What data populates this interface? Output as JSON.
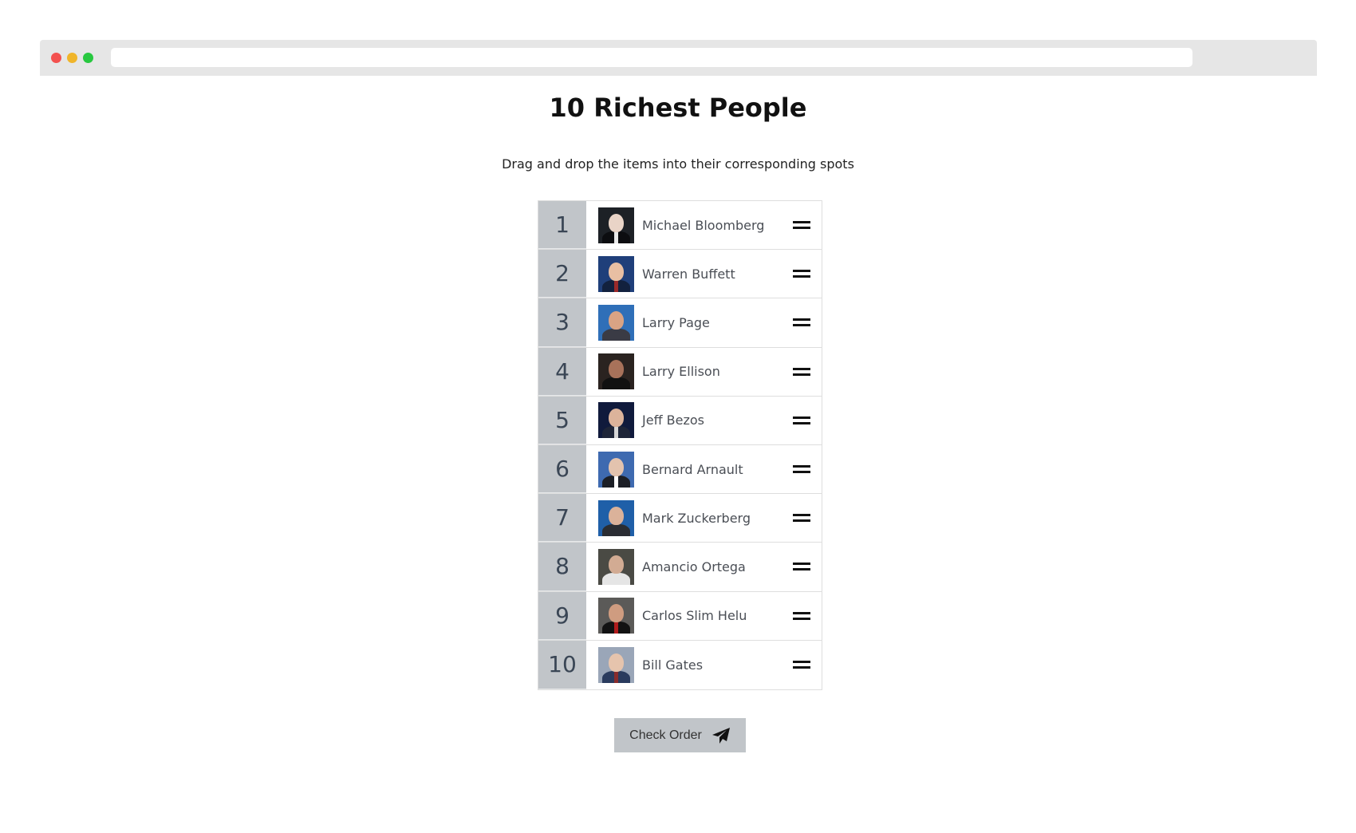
{
  "page": {
    "title": "10 Richest People",
    "subtitle": "Drag and drop the items into their corresponding spots"
  },
  "list": [
    {
      "rank": "1",
      "name": "Michael Bloomberg",
      "avatar": {
        "bg": "#1d2126",
        "skin": "#e9d4c7",
        "suit": "#0c0d10",
        "tie": "#e9e9e9"
      }
    },
    {
      "rank": "2",
      "name": "Warren Buffett",
      "avatar": {
        "bg": "#1f3f7a",
        "skin": "#e8bfa3",
        "suit": "#12213e",
        "tie": "#9a2a2a"
      }
    },
    {
      "rank": "3",
      "name": "Larry Page",
      "avatar": {
        "bg": "#2f6fb8",
        "skin": "#d9a384",
        "suit": "#3a3b45",
        "tie": "#3a3b45"
      }
    },
    {
      "rank": "4",
      "name": "Larry Ellison",
      "avatar": {
        "bg": "#2a2320",
        "skin": "#a8725a",
        "suit": "#111111",
        "tie": "#111111"
      }
    },
    {
      "rank": "5",
      "name": "Jeff Bezos",
      "avatar": {
        "bg": "#101a3c",
        "skin": "#dcb39b",
        "suit": "#1e2538",
        "tie": "#d6d6d6"
      }
    },
    {
      "rank": "6",
      "name": "Bernard Arnault",
      "avatar": {
        "bg": "#3e6ab0",
        "skin": "#e3c3ae",
        "suit": "#1c1f26",
        "tie": "#ffffff"
      }
    },
    {
      "rank": "7",
      "name": "Mark Zuckerberg",
      "avatar": {
        "bg": "#1f5fa8",
        "skin": "#dbb29a",
        "suit": "#2a2d33",
        "tie": "#2a2d33"
      }
    },
    {
      "rank": "8",
      "name": "Amancio Ortega",
      "avatar": {
        "bg": "#4a4a44",
        "skin": "#d2ab93",
        "suit": "#e5e5e5",
        "tie": "#e5e5e5"
      }
    },
    {
      "rank": "9",
      "name": "Carlos Slim Helu",
      "avatar": {
        "bg": "#5b5a58",
        "skin": "#cf9c80",
        "suit": "#121212",
        "tie": "#b01c1c"
      }
    },
    {
      "rank": "10",
      "name": "Bill Gates",
      "avatar": {
        "bg": "#9aa6b8",
        "skin": "#e6c4ad",
        "suit": "#2a3b5e",
        "tie": "#8a2c2c"
      }
    }
  ],
  "actions": {
    "check_label": "Check Order",
    "check_icon": "paper-plane-icon"
  },
  "colors": {
    "rank_bg": "#c1c5c9",
    "button_bg": "#c1c5c9"
  }
}
